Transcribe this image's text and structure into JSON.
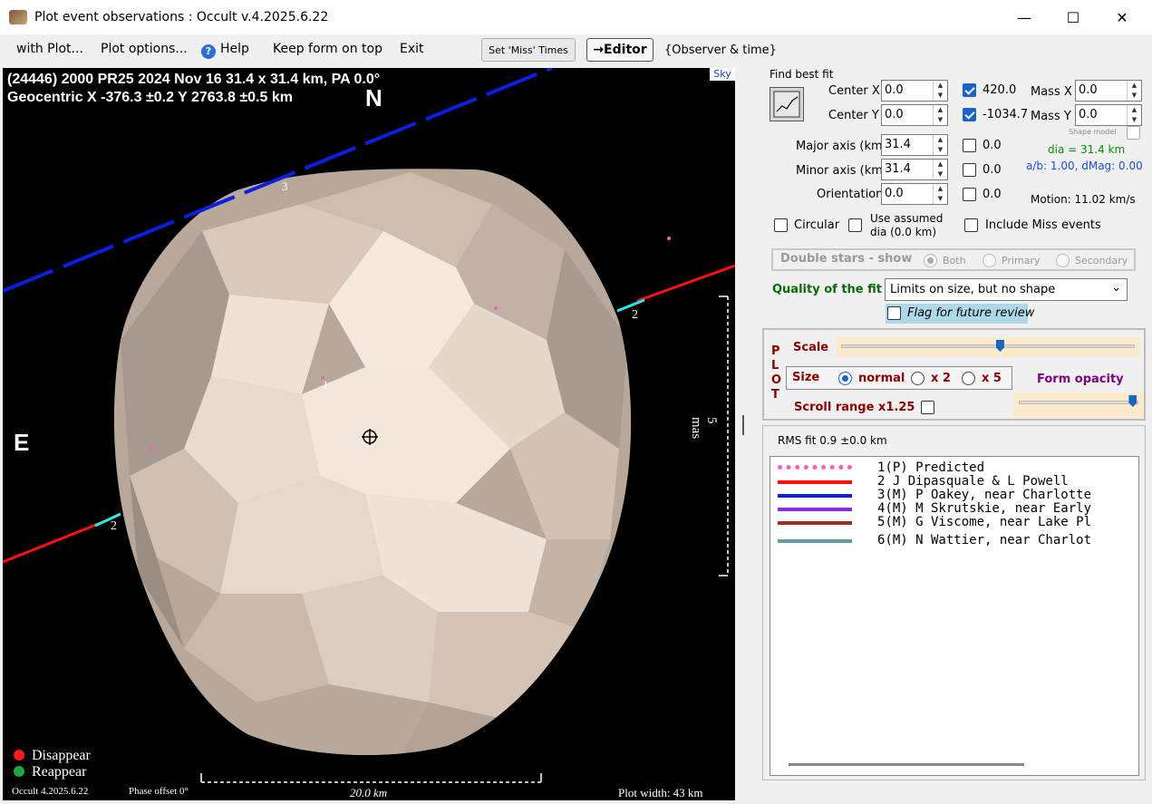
{
  "window": {
    "title": "Plot event observations : Occult v.4.2025.6.22",
    "minimize_glyph": "—",
    "maximize_glyph": "☐",
    "close_glyph": "✕"
  },
  "menu": {
    "with_plot": "with Plot...",
    "plot_options": "Plot options...",
    "help": "Help",
    "keep_on_top": "Keep form on top",
    "exit": "Exit",
    "set_miss_times": "Set 'Miss' Times",
    "editor": "→Editor",
    "observer_time": "{Observer & time}"
  },
  "plot": {
    "header_line1": "(24446) 2000 PR25  2024 Nov 16  31.4 x 31.4 km, PA 0.0°",
    "header_line2": "Geocentric  X  -376.3 ±0.2  Y 2763.8 ±0.5 km",
    "north": "N",
    "east": "E",
    "sky": "Sky",
    "chord_labels": [
      "1",
      "2",
      "2",
      "3"
    ],
    "mas_label": "5 mas",
    "scale_label": "20.0 km",
    "legend": [
      {
        "label": "Disappear",
        "color": "#ff1a1a"
      },
      {
        "label": "Reappear",
        "color": "#1fa83a"
      }
    ],
    "footer_version": "Occult 4.2025.6.22",
    "footer_phase": "Phase offset 0°",
    "footer_width": "Plot width: 43 km"
  },
  "fit": {
    "section": "Find best fit",
    "center_x_label": "Center X",
    "center_x": "0.0",
    "center_y_label": "Center Y",
    "center_y": "0.0",
    "center_x_fixed": "420.0",
    "center_y_fixed": "-1034.7",
    "mass_x_label": "Mass X",
    "mass_x": "0.0",
    "mass_y_label": "Mass Y",
    "mass_y": "0.0",
    "shape_model_label": "Shape model",
    "major_label": "Major axis (km)",
    "major": "31.4",
    "major_fixed": "0.0",
    "minor_label": "Minor axis (km)",
    "minor": "31.4",
    "minor_fixed": "0.0",
    "orient_label": "Orientation",
    "orient": "0.0",
    "orient_fixed": "0.0",
    "dia": "dia = 31.4 km",
    "ab": "a/b: 1.00, dMag: 0.00",
    "motion": "Motion: 11.02 km/s",
    "circular": "Circular",
    "use_assumed": "Use assumed",
    "use_assumed_dia": "dia (0.0 km)",
    "include_miss": "Include Miss events"
  },
  "double_stars": {
    "title": "Double stars - show",
    "both": "Both",
    "primary": "Primary",
    "secondary": "Secondary"
  },
  "quality": {
    "label": "Quality of the fit",
    "value": "Limits on size, but no shape",
    "flag": "Flag for future review"
  },
  "plot_ctrl": {
    "vertical": "PLOT",
    "scale": "Scale",
    "scale_level": 0.54,
    "size": "Size",
    "normal": "normal",
    "x2": "x 2",
    "x5": "x 5",
    "form_opacity": "Form opacity",
    "opacity_level": 0.95,
    "scroll_range": "Scroll range x1.25"
  },
  "rms": "RMS fit 0.9 ±0.0 km",
  "observers": [
    {
      "text": "1(P)  Predicted",
      "color": "#ff5fb0",
      "style": "dotted"
    },
    {
      "text": "2     J Dipasquale & L Powell",
      "color": "#ff1010",
      "style": "solid"
    },
    {
      "text": "3(M)  P Oakey, near Charlotte",
      "color": "#0a1fe0",
      "style": "solid"
    },
    {
      "text": "4(M)  M Skrutskie, near Early",
      "color": "#8a2be2",
      "style": "solid"
    },
    {
      "text": "5(M)  G Viscome, near Lake Pl",
      "color": "#a52a2a",
      "style": "solid"
    },
    {
      "text": "6(M)  N Wattier, near Charlot",
      "color": "#5f9ea0",
      "style": "solid"
    }
  ]
}
